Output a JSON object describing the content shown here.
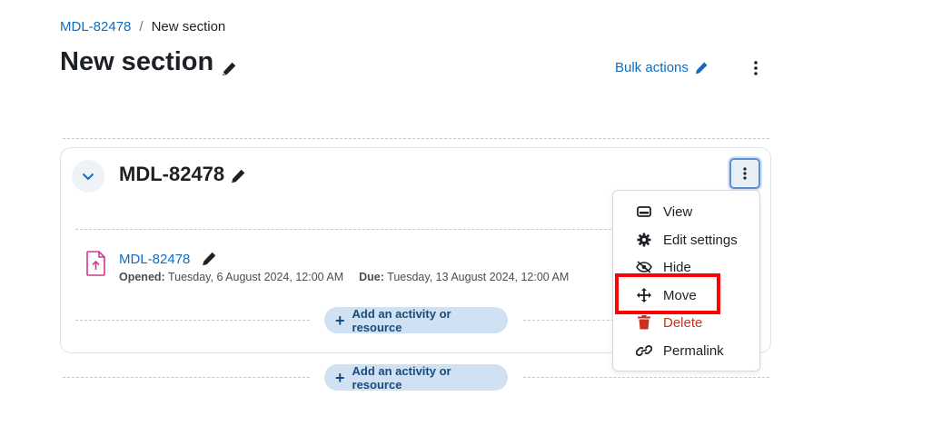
{
  "breadcrumb": {
    "parent": "MDL-82478",
    "separator": "/",
    "current": "New section"
  },
  "page": {
    "title": "New section"
  },
  "header_actions": {
    "bulk_label": "Bulk actions"
  },
  "section": {
    "title": "MDL-82478"
  },
  "activity": {
    "name": "MDL-82478",
    "opened_label": "Opened:",
    "opened_value": "Tuesday, 6 August 2024, 12:00 AM",
    "due_label": "Due:",
    "due_value": "Tuesday, 13 August 2024, 12:00 AM"
  },
  "add_activity": {
    "label": "Add an activity or resource"
  },
  "menu": {
    "items": [
      {
        "label": "View",
        "icon": "view-icon"
      },
      {
        "label": "Edit settings",
        "icon": "gear-icon"
      },
      {
        "label": "Hide",
        "icon": "eye-slash-icon"
      },
      {
        "label": "Move",
        "icon": "move-icon"
      },
      {
        "label": "Delete",
        "icon": "trash-icon"
      },
      {
        "label": "Permalink",
        "icon": "link-icon"
      }
    ]
  },
  "colors": {
    "link": "#0f6cbf",
    "danger": "#ca3120",
    "highlight": "#ff0000",
    "accent_button": "#cfe1f2"
  }
}
